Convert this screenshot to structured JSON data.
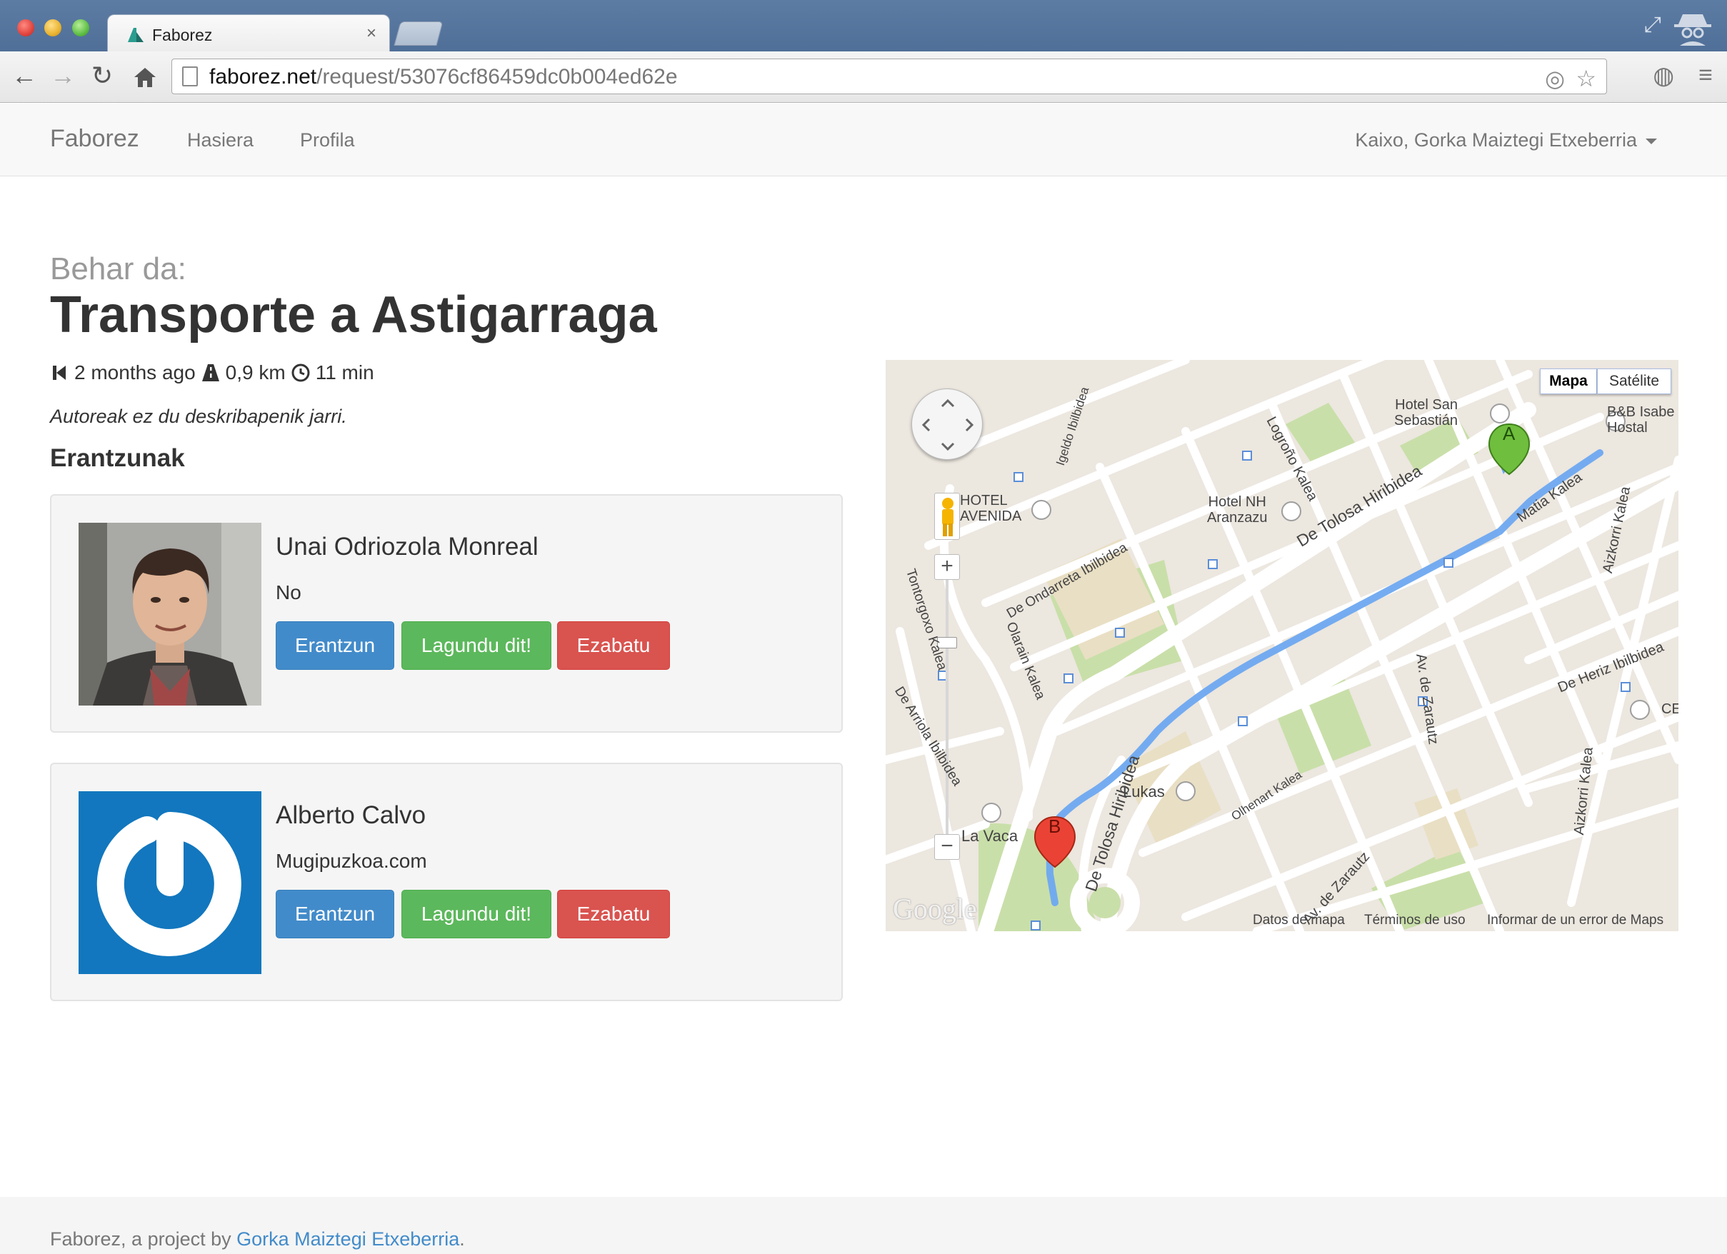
{
  "browser": {
    "tab_title": "Faborez",
    "url_host": "faborez.net",
    "url_path": "/request/53076cf86459dc0b004ed62e"
  },
  "navbar": {
    "brand": "Faborez",
    "links": [
      "Hasiera",
      "Profila"
    ],
    "user_greeting": "Kaixo, Gorka Maiztegi Etxeberria"
  },
  "request": {
    "subtitle": "Behar da:",
    "title": "Transporte a Astigarraga",
    "time_ago": "2 months ago",
    "distance": "0,9 km",
    "duration": "11 min",
    "description": "Autoreak ez du deskribapenik jarri."
  },
  "answers": {
    "heading": "Erantzunak",
    "items": [
      {
        "name": "Unai Odriozola Monreal",
        "text": "No",
        "avatar": "person-photo"
      },
      {
        "name": "Alberto Calvo",
        "text": "Mugipuzkoa.com",
        "avatar": "gravatar-logo"
      }
    ],
    "buttons": {
      "reply": "Erantzun",
      "helped": "Lagundu dit!",
      "delete": "Ezabatu"
    }
  },
  "map": {
    "type_map": "Mapa",
    "type_satellite": "Satélite",
    "marker_a": "A",
    "marker_b": "B",
    "labels": {
      "hotel_san_sebastian": "Hotel San\nSebastián",
      "bb": "B&B Isabe\nHostal",
      "hotel_avenida": "HOTEL\nAVENIDA",
      "hotel_nh": "Hotel NH\nAranzazu",
      "lukas": "Lukas",
      "la_vaca": "La Vaca",
      "de_tolosa": "De Tolosa Hiribidea",
      "matia": "Matia Kalea",
      "logrono": "Logroño Kalea",
      "ondarreta": "De Ondarreta Ibilbidea",
      "zarautz": "Av. de Zarautz",
      "aizkorri": "Aizkorri Kalea",
      "heriz": "De Heriz Ibilbidea",
      "olarain": "Olarain Kalea",
      "olhenart": "Olhenart Kalea",
      "tontorgoxo": "Tontorgoxo Kalea",
      "de_arriola": "De Arriola Ibilbidea",
      "igeldo": "Igeldo Ibilbidea",
      "cei": "CEI"
    },
    "footer_data": "Datos de mapa",
    "footer_terms": "Términos de uso",
    "footer_report": "Informar de un error de Maps",
    "logo": "Google",
    "route_color": "#6ea8f0"
  },
  "footer": {
    "prefix": "Faborez, a project by ",
    "author": "Gorka Maiztegi Etxeberria",
    "suffix": "."
  },
  "colors": {
    "primary": "#428bca",
    "success": "#5cb85c",
    "danger": "#d9534f"
  }
}
